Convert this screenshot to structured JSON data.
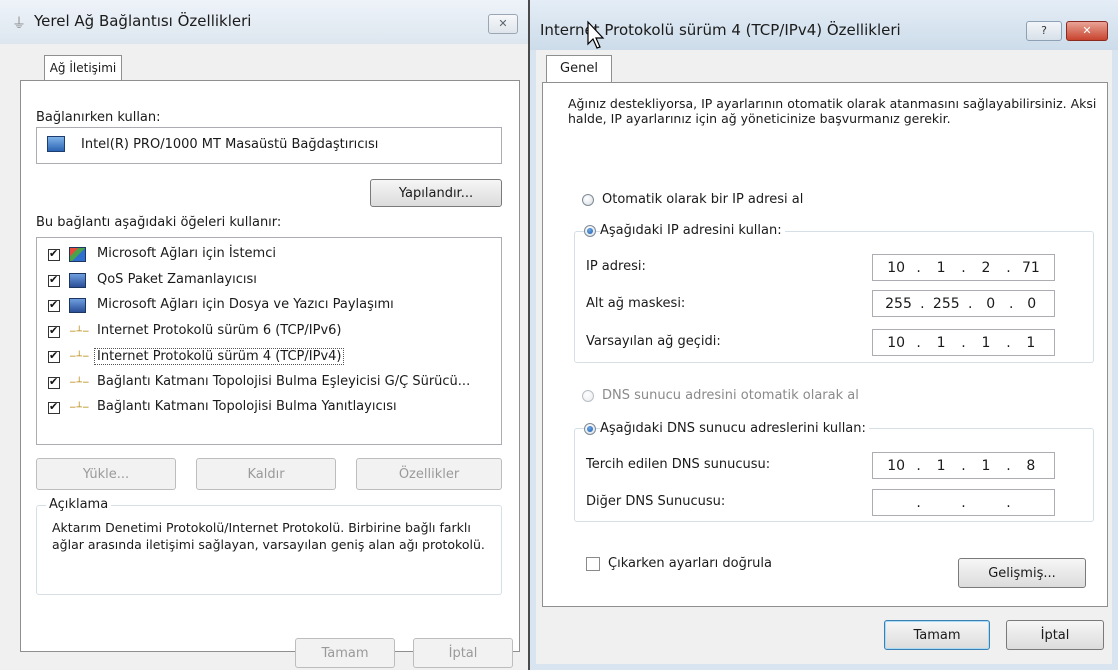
{
  "left_dialog": {
    "title": "Yerel Ağ Bağlantısı Özellikleri",
    "tab": "Ağ İletişimi",
    "connect_using_label": "Bağlanırken kullan:",
    "adapter_name": "Intel(R) PRO/1000 MT Masaüstü Bağdaştırıcısı",
    "configure_button": "Yapılandır...",
    "items_label": "Bu bağlantı aşağıdaki öğeleri kullanır:",
    "items": [
      {
        "label": "Microsoft Ağları için İstemci",
        "checked": true,
        "icon": "network-client-icon"
      },
      {
        "label": "QoS Paket Zamanlayıcısı",
        "checked": true,
        "icon": "service-icon"
      },
      {
        "label": "Microsoft Ağları için Dosya ve Yazıcı Paylaşımı",
        "checked": true,
        "icon": "service-icon"
      },
      {
        "label": "Internet Protokolü sürüm 6 (TCP/IPv6)",
        "checked": true,
        "icon": "protocol-icon"
      },
      {
        "label": "Internet Protokolü sürüm 4 (TCP/IPv4)",
        "checked": true,
        "icon": "protocol-icon"
      },
      {
        "label": "Bağlantı Katmanı Topolojisi Bulma Eşleyicisi G/Ç Sürücü...",
        "checked": true,
        "icon": "protocol-icon"
      },
      {
        "label": "Bağlantı Katmanı Topolojisi Bulma Yanıtlayıcısı",
        "checked": true,
        "icon": "protocol-icon"
      }
    ],
    "install_button": "Yükle...",
    "uninstall_button": "Kaldır",
    "properties_button": "Özellikler",
    "description_title": "Açıklama",
    "description_text": "Aktarım Denetimi Protokolü/Internet Protokolü. Birbirine bağlı farklı ağlar arasında iletişimi sağlayan, varsayılan geniş alan ağı protokolü.",
    "ok_button": "Tamam",
    "cancel_button": "İptal",
    "close_glyph": "✕"
  },
  "right_dialog": {
    "title": "Internet Protokolü sürüm 4 (TCP/IPv4) Özellikleri",
    "help_glyph": "?",
    "close_glyph": "✕",
    "tab": "Genel",
    "intro_text": "Ağınız destekliyorsa, IP ayarlarının otomatik olarak atanmasını sağlayabilirsiniz. Aksi halde, IP ayarlarınız için ağ yöneticinize başvurmanız gerekir.",
    "auto_ip_label": "Otomatik olarak bir IP adresi al",
    "manual_ip_label": "Aşağıdaki IP adresini kullan:",
    "ip_label": "IP adresi:",
    "ip_value": [
      "10",
      "1",
      "2",
      "71"
    ],
    "mask_label": "Alt ağ maskesi:",
    "mask_value": [
      "255",
      "255",
      "0",
      "0"
    ],
    "gateway_label": "Varsayılan ağ geçidi:",
    "gateway_value": [
      "10",
      "1",
      "1",
      "1"
    ],
    "auto_dns_label": "DNS sunucu adresini otomatik olarak al",
    "manual_dns_label": "Aşağıdaki DNS sunucu adreslerini kullan:",
    "preferred_dns_label": "Tercih edilen DNS sunucusu:",
    "preferred_dns_value": [
      "10",
      "1",
      "1",
      "8"
    ],
    "alternate_dns_label": "Diğer DNS Sunucusu:",
    "alternate_dns_value": [
      "",
      "",
      "",
      ""
    ],
    "validate_label": "Çıkarken ayarları doğrula",
    "advanced_button": "Gelişmiş...",
    "ok_button": "Tamam",
    "cancel_button": "İptal"
  }
}
